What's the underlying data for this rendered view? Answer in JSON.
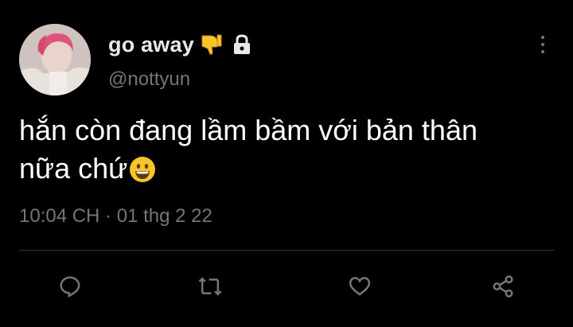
{
  "tweet": {
    "display_name": "go away",
    "display_name_emoji": "thumbs-down-emoji",
    "lock_icon": "lock-icon",
    "handle": "@nottyun",
    "text_line_1": "hắn còn đang lầm bầm với bản thân",
    "text_line_2": "nữa chứ",
    "text_emoji": "grinning-face-emoji",
    "timestamp": "10:04 CH · 01 thg 2 22"
  },
  "actions": [
    "reply-icon",
    "retweet-icon",
    "like-icon",
    "share-icon"
  ],
  "colors": {
    "background": "#000000",
    "text_primary": "#ffffff",
    "text_secondary": "#71767b",
    "divider": "#2f3336",
    "emoji_yellow": "#f7c52b"
  }
}
